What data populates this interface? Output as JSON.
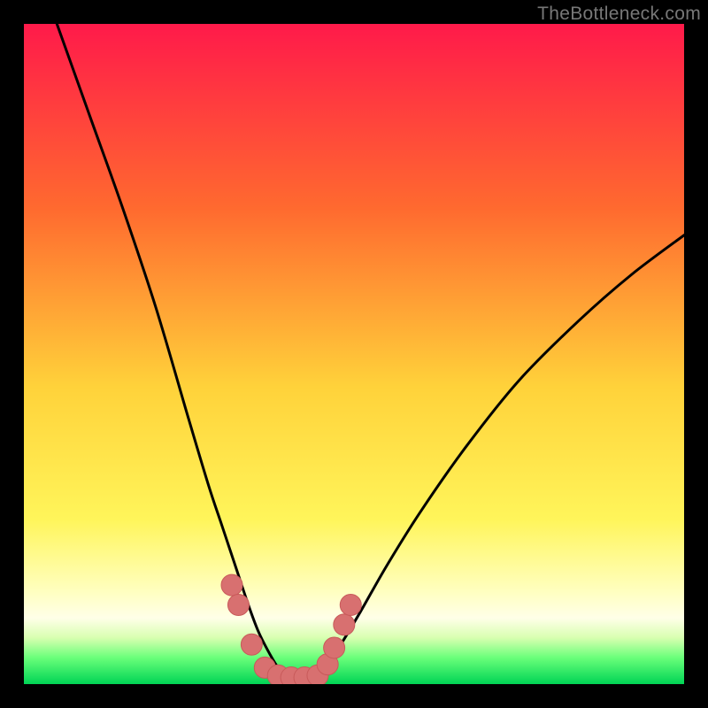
{
  "attribution": "TheBottleneck.com",
  "colors": {
    "top": "#ff1a4a",
    "mid_upper": "#ff8a2a",
    "mid": "#ffe23a",
    "lower_yellow": "#ffff70",
    "pale": "#ffffe0",
    "green_light": "#b8ff9a",
    "green": "#17ff4a",
    "green_deep": "#00c84e",
    "curve_stroke": "#000000",
    "marker_fill": "#d87070",
    "marker_stroke": "#c85a5a"
  },
  "chart_data": {
    "type": "line",
    "title": "",
    "xlabel": "",
    "ylabel": "",
    "xlim": [
      0,
      100
    ],
    "ylim": [
      0,
      100
    ],
    "series": [
      {
        "name": "left-curve",
        "x": [
          5,
          10,
          15,
          20,
          25,
          28,
          30,
          32,
          34,
          35.5,
          37,
          38.5,
          40
        ],
        "y": [
          100,
          86,
          72,
          57,
          40,
          30,
          24,
          18,
          12,
          8,
          5,
          2.5,
          1
        ]
      },
      {
        "name": "right-curve",
        "x": [
          44,
          46,
          48,
          51,
          55,
          60,
          67,
          75,
          84,
          92,
          100
        ],
        "y": [
          1,
          3,
          6,
          11,
          18,
          26,
          36,
          46,
          55,
          62,
          68
        ]
      }
    ],
    "markers": {
      "name": "bottom-dots",
      "x": [
        31.5,
        32.5,
        34.5,
        36.5,
        38.5,
        40.5,
        42.5,
        44.5,
        46,
        47,
        48.5,
        49.5
      ],
      "y": [
        15,
        12,
        6,
        2.5,
        1.3,
        1,
        1,
        1.3,
        3,
        5.5,
        9,
        12
      ]
    }
  }
}
